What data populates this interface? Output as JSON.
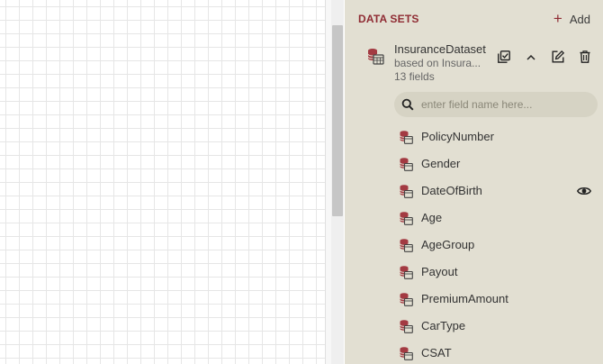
{
  "panel": {
    "title": "DATA SETS",
    "add_label": "Add"
  },
  "dataset": {
    "name": "InsuranceDataset",
    "subtitle": "based on Insura...",
    "field_count": "13 fields"
  },
  "search": {
    "placeholder": "enter field name here..."
  },
  "fields": [
    {
      "label": "PolicyNumber"
    },
    {
      "label": "Gender"
    },
    {
      "label": "DateOfBirth"
    },
    {
      "label": "Age"
    },
    {
      "label": "AgeGroup"
    },
    {
      "label": "Payout"
    },
    {
      "label": "PremiumAmount"
    },
    {
      "label": "CarType"
    },
    {
      "label": "CSAT"
    }
  ],
  "colors": {
    "accent": "#8f2b33",
    "panel_bg": "#e2dfd2",
    "search_bg": "#d6d3c4"
  },
  "icons": {
    "add": "plus-icon",
    "dataset": "database-table-icon",
    "field": "database-field-icon",
    "select": "select-fields-icon",
    "collapse": "chevron-up-icon",
    "edit": "edit-icon",
    "delete": "trash-icon",
    "search": "search-icon",
    "visibility": "eye-icon"
  }
}
